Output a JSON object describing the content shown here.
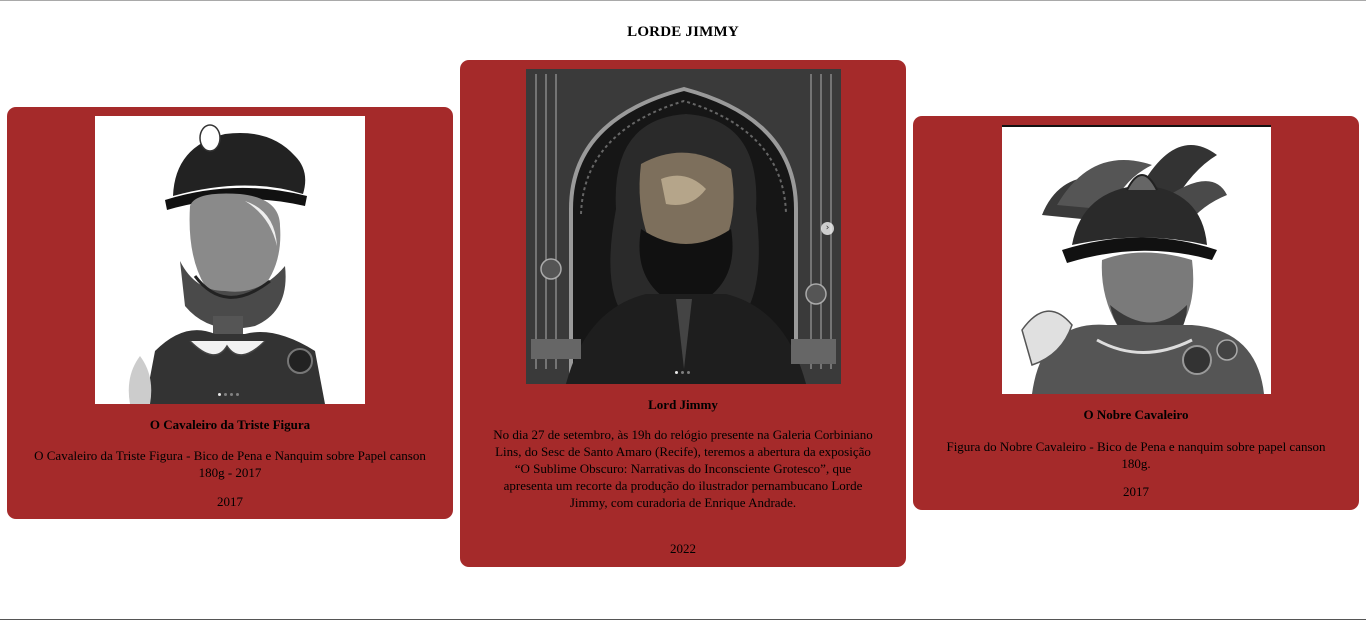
{
  "page": {
    "title": "LORDE JIMMY"
  },
  "cards": [
    {
      "title": "O Cavaleiro da Triste Figura",
      "description": "O Cavaleiro da Triste Figura - Bico de Pena e Nanquim sobre Papel canson 180g - 2017",
      "year": "2017",
      "image_icon": "knight-sad-figure-illustration",
      "carousel_pages": 4,
      "carousel_active": 1
    },
    {
      "title": "Lord Jimmy",
      "description": "No dia 27 de setembro, às 19h do relógio presente na Galeria Corbiniano Lins, do Sesc de Santo Amaro (Recife), teremos a abertura da exposição “O Sublime Obscuro: Narrativas do Inconsciente Grotesco”, que apresenta um recorte da produção do ilustrador pernambucano Lorde Jimmy, com curadoria de Enrique Andrade.",
      "year": "2022",
      "image_icon": "bearded-man-portrait-illustration",
      "carousel_pages": 3,
      "carousel_active": 1,
      "next_arrow": "›"
    },
    {
      "title": "O Nobre Cavaleiro",
      "description": "Figura do Nobre Cavaleiro - Bico de Pena e nanquim sobre papel canson 180g.",
      "year": "2017",
      "image_icon": "noble-knight-plumed-helmet-illustration"
    }
  ],
  "colors": {
    "card_background": "#a52a2a",
    "page_background": "#ffffff"
  }
}
